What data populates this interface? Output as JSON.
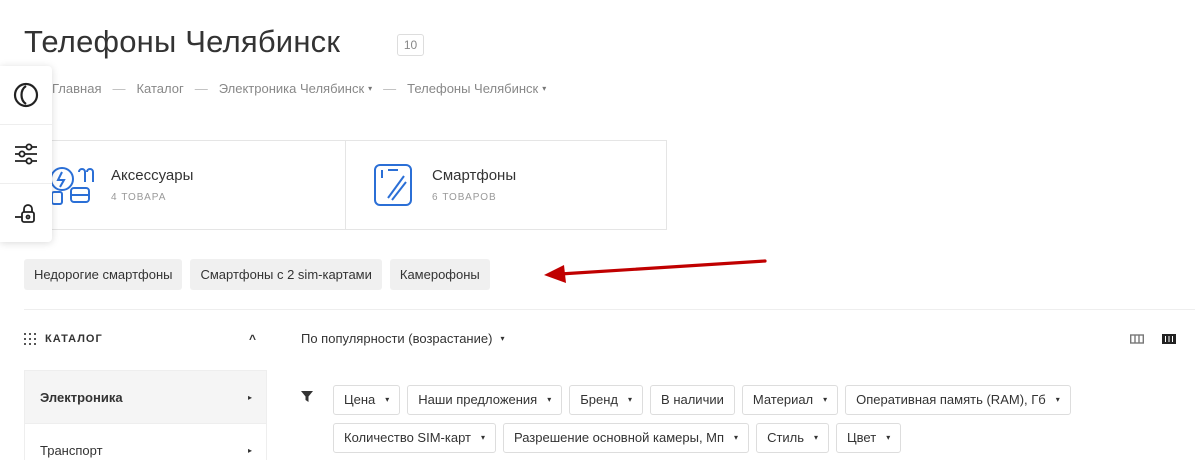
{
  "page": {
    "title": "Телефоны Челябинск",
    "count": "10"
  },
  "breadcrumb": {
    "home": "Главная",
    "catalog": "Каталог",
    "electronics": "Электроника Челябинск",
    "phones": "Телефоны Челябинск",
    "separator": "—",
    "caret": "▾"
  },
  "side_tools": [
    {
      "icon": "circle-logo-icon"
    },
    {
      "icon": "sliders-icon"
    },
    {
      "icon": "lock-share-icon"
    }
  ],
  "categories": [
    {
      "name": "Аксессуары",
      "sub": "4 ТОВАРА",
      "icon": "accessories-icon"
    },
    {
      "name": "Смартфоны",
      "sub": "6 ТОВАРОВ",
      "icon": "smartphone-icon"
    }
  ],
  "tags": [
    "Недорогие смартфоны",
    "Смартфоны с 2 sim-картами",
    "Камерофоны"
  ],
  "colors": {
    "accent_blue": "#2b6fd6",
    "arrow_red": "#c00000"
  },
  "catalog": {
    "heading": "КАТАЛОГ",
    "chevron": "^",
    "items": [
      {
        "label": "Электроника",
        "caret": "▸"
      },
      {
        "label": "Транспорт",
        "caret": "▸"
      }
    ]
  },
  "sort": {
    "label": "По популярности (возрастание)",
    "caret": "▾"
  },
  "filters": [
    {
      "label": "Цена",
      "caret": "▾"
    },
    {
      "label": "Наши предложения",
      "caret": "▾"
    },
    {
      "label": "Бренд",
      "caret": "▾"
    },
    {
      "label": "В наличии",
      "caret": ""
    },
    {
      "label": "Материал",
      "caret": "▾"
    },
    {
      "label": "Оперативная память (RAM), Гб",
      "caret": "▾"
    },
    {
      "label": "Количество SIM-карт",
      "caret": "▾"
    },
    {
      "label": "Разрешение основной камеры, Мп",
      "caret": "▾"
    },
    {
      "label": "Стиль",
      "caret": "▾"
    },
    {
      "label": "Цвет",
      "caret": "▾"
    }
  ]
}
